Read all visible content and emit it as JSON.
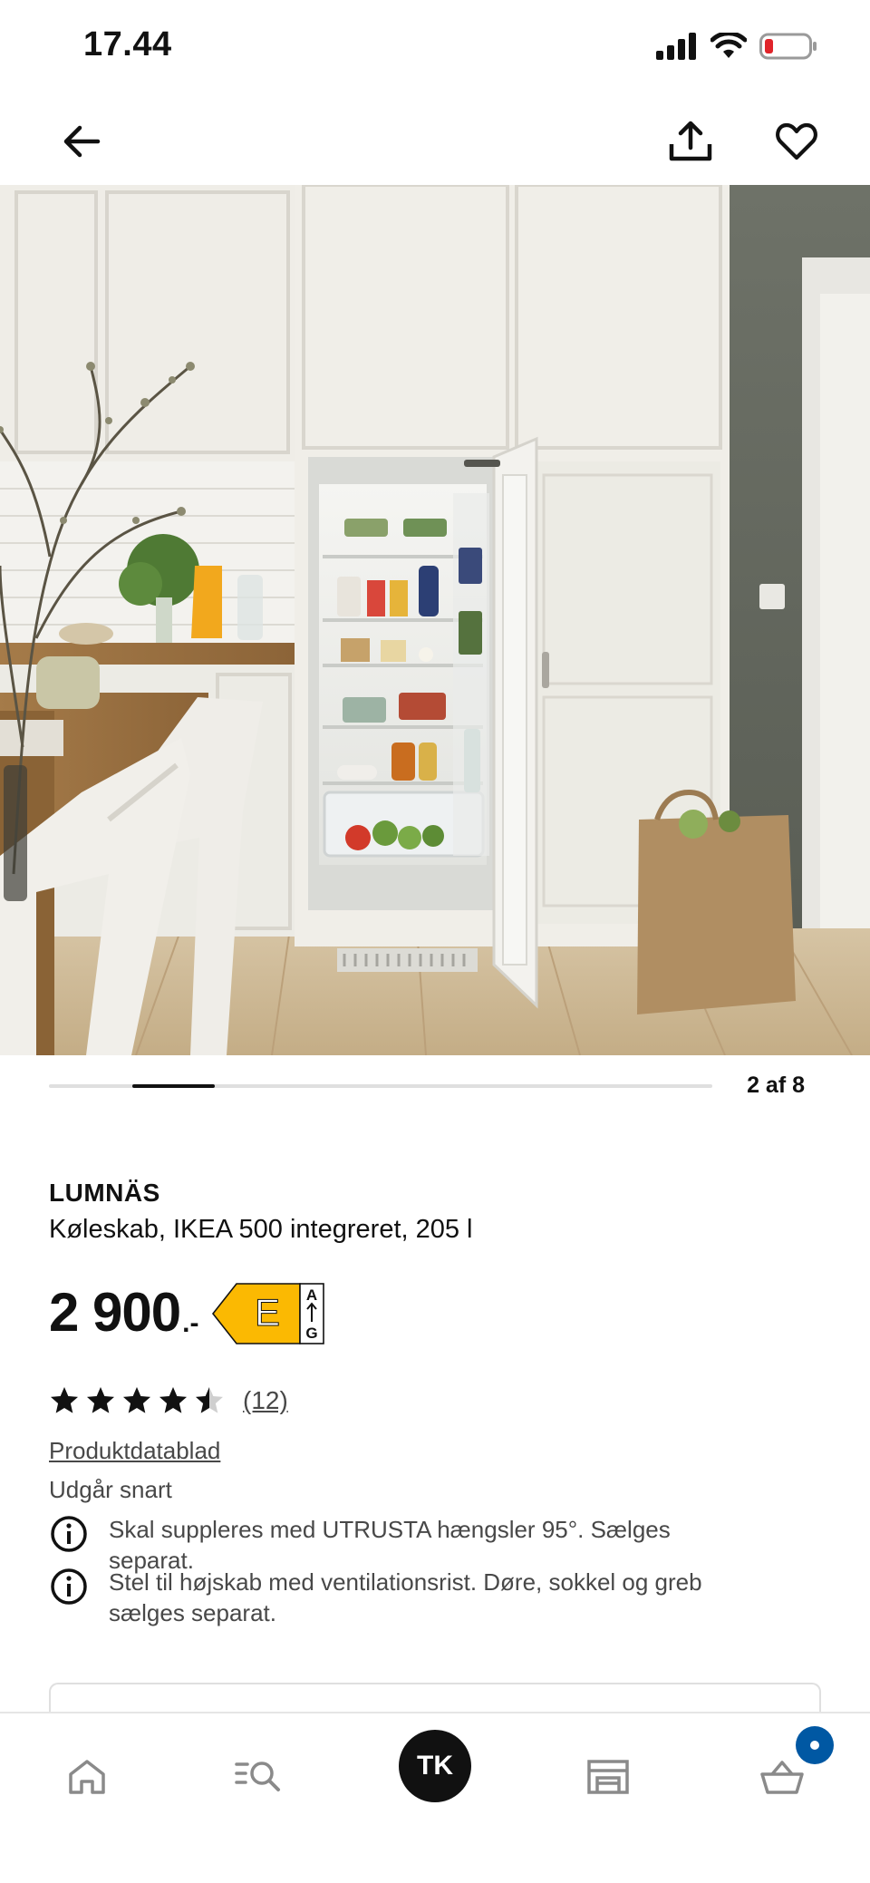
{
  "status_bar": {
    "time": "17.44",
    "icons": [
      "cellular-signal-icon",
      "wifi-icon",
      "battery-low-icon"
    ]
  },
  "nav": {
    "back_icon": "arrow-left-icon",
    "share_icon": "share-icon",
    "favorite_icon": "heart-icon"
  },
  "gallery": {
    "counter": "2 af 8",
    "current": 2,
    "total": 8
  },
  "product": {
    "name": "LUMNÄS",
    "description": "Køleskab, IKEA 500 integreret, 205 l",
    "price": "2 900",
    "price_suffix": ".-",
    "energy_class": "E",
    "energy_scale_top": "A",
    "energy_scale_bottom": "G",
    "rating": 4.5,
    "rating_max": 5,
    "rating_count": "(12)",
    "datasheet_link": "Produktdatablad",
    "availability": "Udgår snart",
    "info": [
      "Skal suppleres med UTRUSTA hængsler 95°. Sælges separat.",
      "Stel til højskab med ventilationsrist. Døre, sokkel og greb sælges separat."
    ]
  },
  "tab_bar": {
    "home_icon": "home-icon",
    "search_icon": "search-list-icon",
    "avatar_initials": "TK",
    "store_icon": "store-icon",
    "cart_icon": "basket-icon"
  },
  "colors": {
    "text": "#111111",
    "secondary_text": "#484848",
    "energy_label": "#fbb902",
    "accent_blue": "#0058a3",
    "battery_low": "#e0242a"
  }
}
